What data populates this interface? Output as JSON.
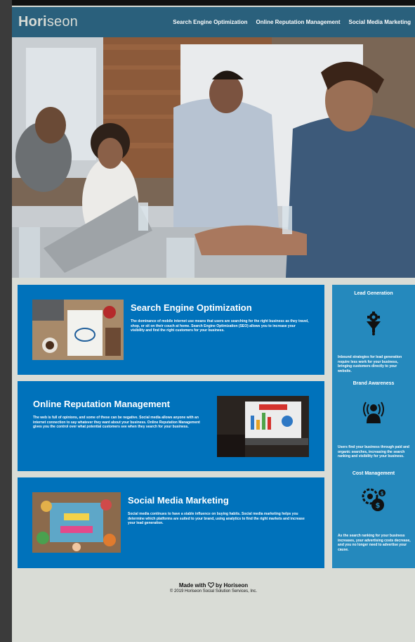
{
  "header": {
    "logo_main": "Hori",
    "logo_accent": "seon",
    "nav": [
      "Search Engine Optimization",
      "Online Reputation Management",
      "Social Media Marketing"
    ]
  },
  "cards": [
    {
      "title": "Search Engine Optimization",
      "text": "The dominance of mobile internet use means that users are searching for the right business as they travel, shop, or sit on their couch at home. Search Engine Optimization (SEO) allows you to increase your visibility and find the right customers for your business."
    },
    {
      "title": "Online Reputation Management",
      "text": "The web is full of opinions, and some of these can be negative. Social media allows anyone with an internet connection to say whatever they want about your business. Online Reputation Management gives you the control over what potential customers see when they search for your business."
    },
    {
      "title": "Social Media Marketing",
      "text": "Social media continues to have a stable influence on buying habits. Social media marketing helps you determine which platforms are suited to your brand, using analytics to find the right markets and increase your lead generation."
    }
  ],
  "benefits": [
    {
      "title": "Lead Generation",
      "icon": "lead-generation-icon",
      "text": "Inbound strategies for lead generation require less work for your business, bringing customers directly to your website."
    },
    {
      "title": "Brand Awareness",
      "icon": "brand-awareness-icon",
      "text": "Users find your business through paid and organic searches, increasing the search ranking and visibility for your business."
    },
    {
      "title": "Cost Management",
      "icon": "cost-management-icon",
      "text": "As the search ranking for your business increases, your advertising costs decrease, and you no longer need to advertise your cause."
    }
  ],
  "footer": {
    "made_with": "Made with",
    "by": "by Horiseon",
    "copyright": "© 2019 Horiseon Social Solution Services, Inc."
  },
  "colors": {
    "header_bg": "#2a607c",
    "card_bg": "#0072bb",
    "aside_bg": "#2589bd",
    "page_bg": "#d9dcd6"
  }
}
